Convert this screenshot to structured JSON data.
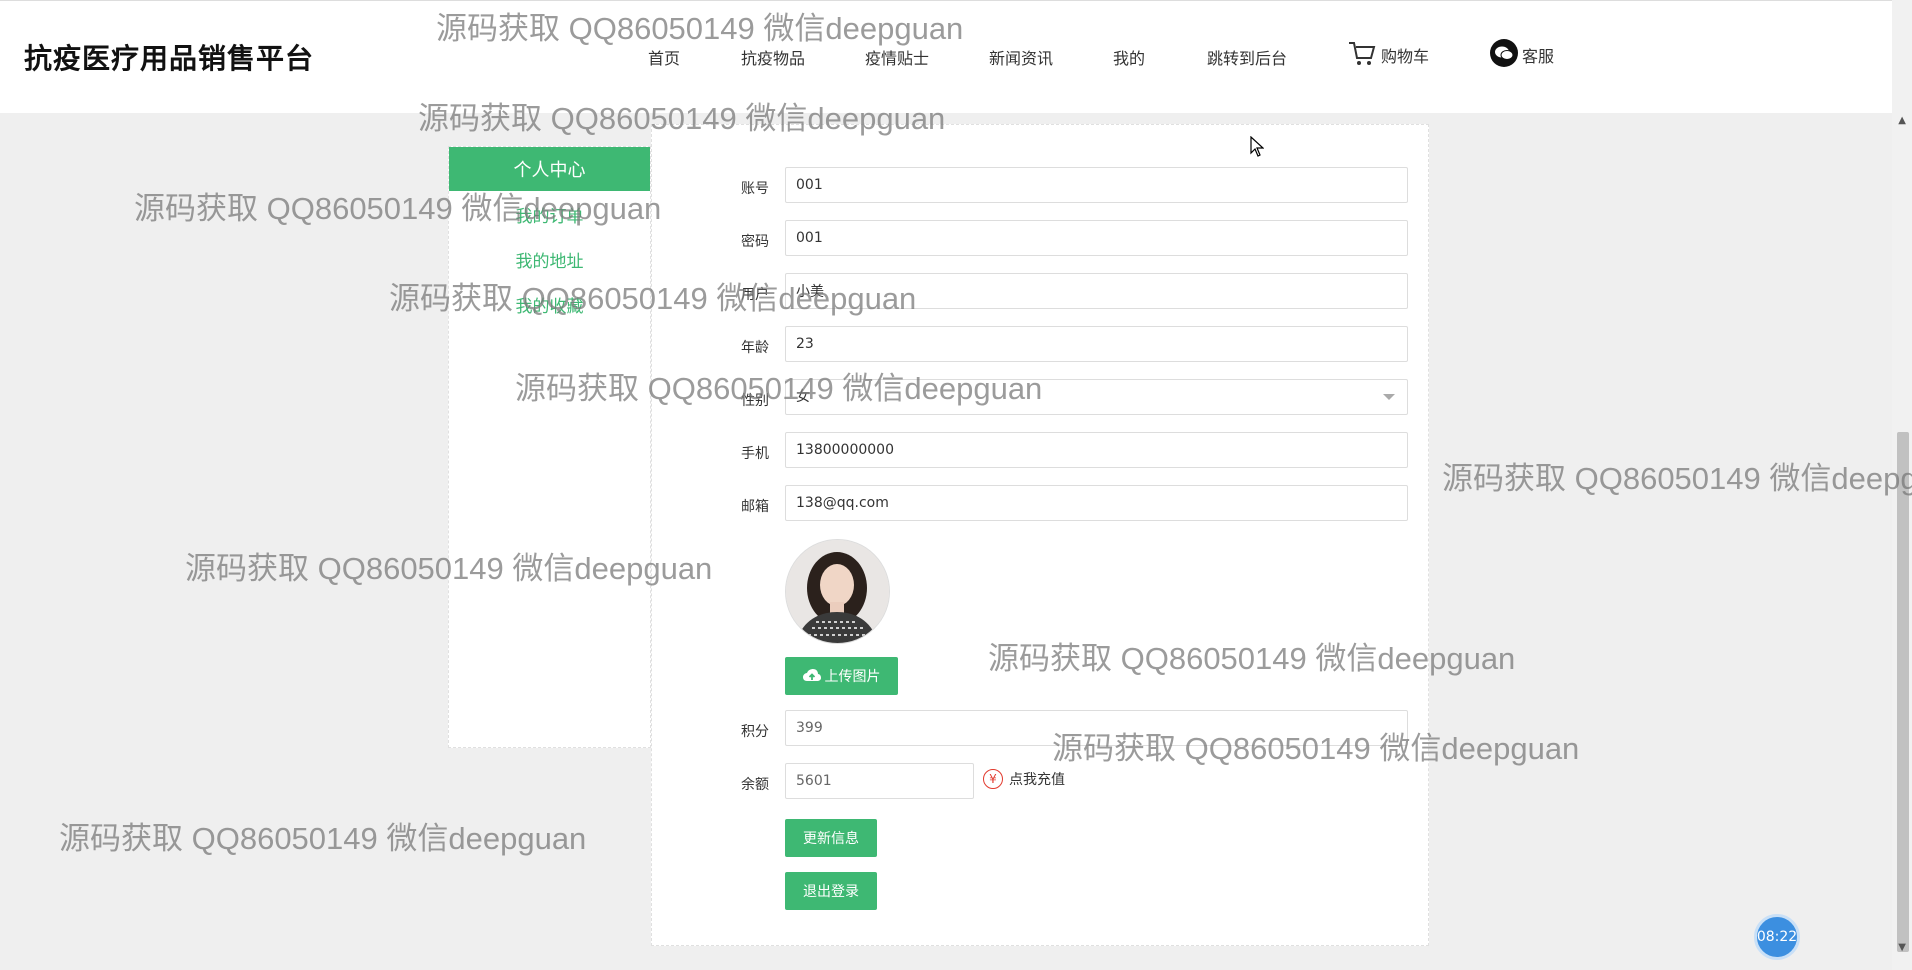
{
  "site": {
    "brand": "抗疫医疗用品销售平台"
  },
  "nav": {
    "items": [
      "首页",
      "抗疫物品",
      "疫情贴士",
      "新闻资讯",
      "我的",
      "跳转到后台"
    ],
    "cart": "购物车",
    "service": "客服"
  },
  "sidebar": {
    "title": "个人中心",
    "links": [
      "我的订单",
      "我的地址",
      "我的收藏"
    ]
  },
  "form": {
    "fields": [
      {
        "label": "账号",
        "value": "001"
      },
      {
        "label": "密码",
        "value": "001"
      },
      {
        "label": "用户",
        "value": "小美"
      },
      {
        "label": "年龄",
        "value": "23"
      },
      {
        "label": "性别",
        "value": "女"
      },
      {
        "label": "手机",
        "value": "13800000000"
      },
      {
        "label": "邮箱",
        "value": "138@qq.com"
      }
    ],
    "upload": "上传图片",
    "points": {
      "label": "积分",
      "value": "399"
    },
    "balance": {
      "label": "余额",
      "value": "5601"
    },
    "recharge": "点我充值",
    "update": "更新信息",
    "logout": "退出登录"
  },
  "watermark": "源码获取 QQ86050149 微信deepguan",
  "clock": "08:22",
  "colors": {
    "accent": "#3eb873",
    "recharge_icon": "#e23a2e"
  }
}
